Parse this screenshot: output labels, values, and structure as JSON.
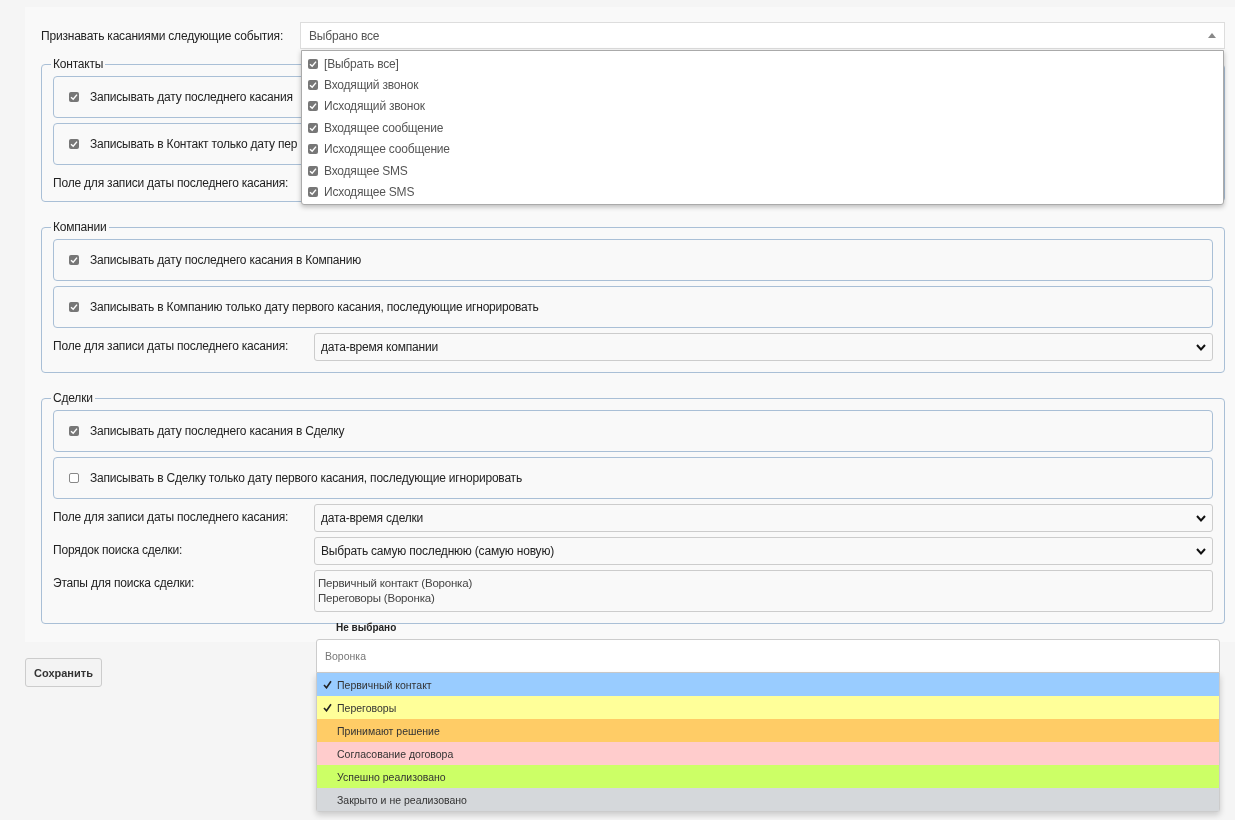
{
  "events_field": {
    "label": "Признавать касаниями следующие события:",
    "value": "Выбрано все",
    "expanded": true,
    "options": [
      {
        "label": "[Выбрать все]",
        "checked": true
      },
      {
        "label": "Входящий звонок",
        "checked": true
      },
      {
        "label": "Исходящий звонок",
        "checked": true
      },
      {
        "label": "Входящее сообщение",
        "checked": true
      },
      {
        "label": "Исходящее сообщение",
        "checked": true
      },
      {
        "label": "Входящее SMS",
        "checked": true
      },
      {
        "label": "Исходящее SMS",
        "checked": true
      }
    ]
  },
  "sections": [
    {
      "title": "Контакты",
      "checks": [
        {
          "label": "Записывать дату последнего касания",
          "checked": true
        },
        {
          "label": "Записывать в Контакт только дату пер",
          "checked": true
        }
      ],
      "fields": [
        {
          "kind": "label",
          "label": "Поле для записи даты последнего касания:"
        }
      ]
    },
    {
      "title": "Компании",
      "checks": [
        {
          "label": "Записывать дату последнего касания в Компанию",
          "checked": true
        },
        {
          "label": "Записывать в Компанию только дату первого касания, последующие игнорировать",
          "checked": true
        }
      ],
      "fields": [
        {
          "kind": "select",
          "label": "Поле для записи даты последнего касания:",
          "value": "дата-время компании"
        }
      ]
    },
    {
      "title": "Сделки",
      "checks": [
        {
          "label": "Записывать дату последнего касания в Сделку",
          "checked": true
        },
        {
          "label": "Записывать в Сделку только дату первого касания, последующие игнорировать",
          "checked": false
        }
      ],
      "fields": [
        {
          "kind": "select",
          "label": "Поле для записи даты последнего касания:",
          "value": "дата-время сделки"
        },
        {
          "kind": "select",
          "label": "Порядок поиска сделки:",
          "value": "Выбрать самую последнюю (самую новую)"
        },
        {
          "kind": "list",
          "label": "Этапы для поиска сделки:",
          "values": [
            "Первичный контакт (Воронка)",
            "Переговоры (Воронка)"
          ]
        }
      ]
    }
  ],
  "stage_dropdown": {
    "header": "Не выбрано",
    "search_placeholder": "Воронка",
    "items": [
      {
        "label": "Первичный контакт",
        "selected": true,
        "color": "#99ccff"
      },
      {
        "label": "Переговоры",
        "selected": true,
        "color": "#ffff99"
      },
      {
        "label": "Принимают решение",
        "selected": false,
        "color": "#ffcc66"
      },
      {
        "label": "Согласование договора",
        "selected": false,
        "color": "#ffcccc"
      },
      {
        "label": "Успешно реализовано",
        "selected": false,
        "color": "#ccff66"
      },
      {
        "label": "Закрыто и не реализовано",
        "selected": false,
        "color": "#d5d8db"
      }
    ]
  },
  "save_button": "Сохранить"
}
